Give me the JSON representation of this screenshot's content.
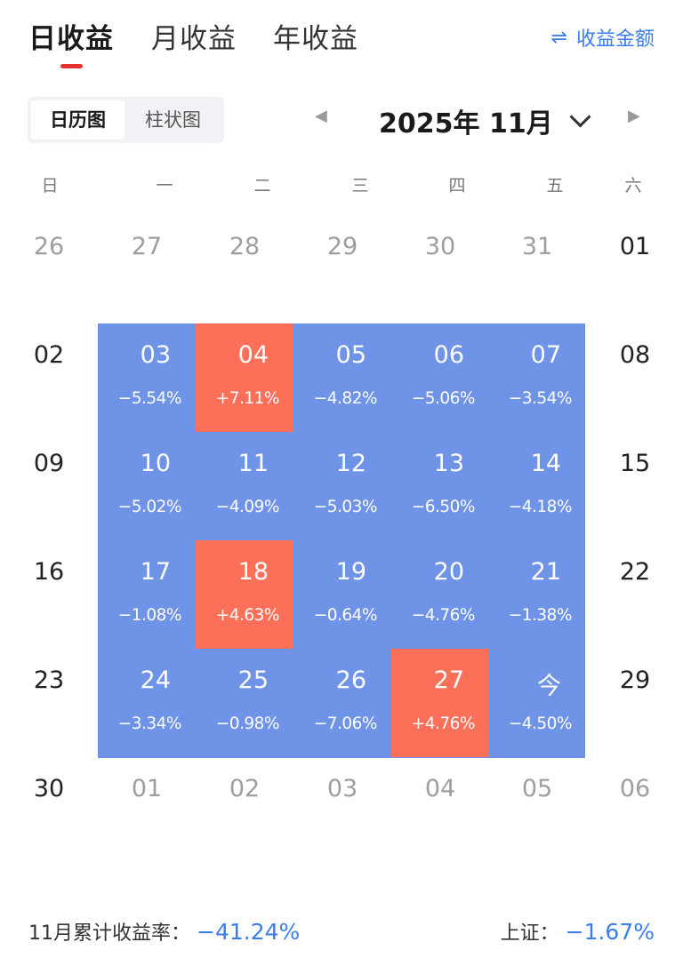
{
  "tabs": [
    {
      "label": "日收益",
      "active": true
    },
    {
      "label": "月收益",
      "active": false
    },
    {
      "label": "年收益",
      "active": false
    }
  ],
  "toggle": {
    "icon": "swap-arrows-icon",
    "label": "收益金额"
  },
  "view_switch": [
    {
      "label": "日历图",
      "active": true
    },
    {
      "label": "柱状图",
      "active": false
    }
  ],
  "month_selector": {
    "title": "2025年 11月"
  },
  "weekdays": [
    "日",
    "一",
    "二",
    "三",
    "四",
    "五",
    "六"
  ],
  "colors": {
    "loss": "#6f93e6",
    "gain": "#fc705a",
    "accent": "#3b7de9",
    "tab_underline": "#e8322e"
  },
  "calendar": [
    [
      {
        "day": "26",
        "state": "muted"
      },
      {
        "day": "27",
        "state": "muted"
      },
      {
        "day": "28",
        "state": "muted"
      },
      {
        "day": "29",
        "state": "muted"
      },
      {
        "day": "30",
        "state": "muted"
      },
      {
        "day": "31",
        "state": "muted"
      },
      {
        "day": "01",
        "state": "normal"
      }
    ],
    [
      {
        "day": "02",
        "state": "normal"
      },
      {
        "day": "03",
        "state": "loss",
        "pct": "−5.54%"
      },
      {
        "day": "04",
        "state": "gain",
        "pct": "+7.11%"
      },
      {
        "day": "05",
        "state": "loss",
        "pct": "−4.82%"
      },
      {
        "day": "06",
        "state": "loss",
        "pct": "−5.06%"
      },
      {
        "day": "07",
        "state": "loss",
        "pct": "−3.54%"
      },
      {
        "day": "08",
        "state": "normal"
      }
    ],
    [
      {
        "day": "09",
        "state": "normal"
      },
      {
        "day": "10",
        "state": "loss",
        "pct": "−5.02%"
      },
      {
        "day": "11",
        "state": "loss",
        "pct": "−4.09%"
      },
      {
        "day": "12",
        "state": "loss",
        "pct": "−5.03%"
      },
      {
        "day": "13",
        "state": "loss",
        "pct": "−6.50%"
      },
      {
        "day": "14",
        "state": "loss",
        "pct": "−4.18%"
      },
      {
        "day": "15",
        "state": "normal"
      }
    ],
    [
      {
        "day": "16",
        "state": "normal"
      },
      {
        "day": "17",
        "state": "loss",
        "pct": "−1.08%"
      },
      {
        "day": "18",
        "state": "gain",
        "pct": "+4.63%"
      },
      {
        "day": "19",
        "state": "loss",
        "pct": "−0.64%"
      },
      {
        "day": "20",
        "state": "loss",
        "pct": "−4.76%"
      },
      {
        "day": "21",
        "state": "loss",
        "pct": "−1.38%"
      },
      {
        "day": "22",
        "state": "normal"
      }
    ],
    [
      {
        "day": "23",
        "state": "normal"
      },
      {
        "day": "24",
        "state": "loss",
        "pct": "−3.34%"
      },
      {
        "day": "25",
        "state": "loss",
        "pct": "−0.98%"
      },
      {
        "day": "26",
        "state": "loss",
        "pct": "−7.06%"
      },
      {
        "day": "27",
        "state": "gain",
        "pct": "+4.76%"
      },
      {
        "day": "今",
        "state": "loss",
        "pct": "−4.50%"
      },
      {
        "day": "29",
        "state": "normal"
      }
    ],
    [
      {
        "day": "30",
        "state": "normal"
      },
      {
        "day": "01",
        "state": "muted"
      },
      {
        "day": "02",
        "state": "muted"
      },
      {
        "day": "03",
        "state": "muted"
      },
      {
        "day": "04",
        "state": "muted"
      },
      {
        "day": "05",
        "state": "muted"
      },
      {
        "day": "06",
        "state": "muted"
      }
    ]
  ],
  "footer": {
    "cumulative_label": "11月累计收益率：",
    "cumulative_value": "−41.24%",
    "index_label": "上证：",
    "index_value": "−1.67%"
  }
}
